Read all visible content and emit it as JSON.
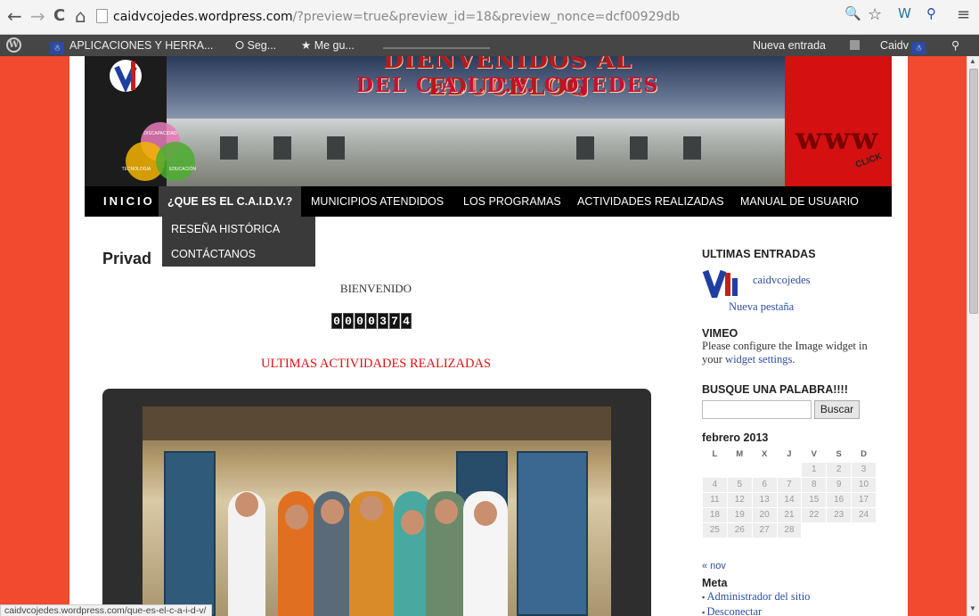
{
  "browser": {
    "url_host": "caidvcojedes.wordpress.com",
    "url_rest": "/?preview=true&preview_id=18&preview_nonce=dcf00929db",
    "back_glyph": "←",
    "forward_glyph": "→",
    "reload_glyph": "C",
    "home_glyph": "⌂",
    "zoom_glyph": "🔍",
    "star_glyph": "☆",
    "menu_glyph": "≡"
  },
  "admin_bar": {
    "site_name": "APLICACIONES Y HERRA...",
    "item2": "Seg...",
    "item3": "Me gu...",
    "new_entry": "Nueva entrada",
    "user": "Caidv"
  },
  "header": {
    "title": "DIENVENIDOS AL EDUCBLOG",
    "subtitle": "DEL C.A.I.D.V. COJEDES",
    "venn_labels": [
      "DISCAPACIDAD",
      "TECNOLOGIA",
      "EDUCACIÓN"
    ],
    "www": "www",
    "click": "CLICK"
  },
  "nav": {
    "home": "INICIO",
    "what": "¿QUE ES EL C.A.I.D.V.?",
    "municipalities": "MUNICIPIOS ATENDIDOS",
    "programs": "LOS PROGRAMAS",
    "activities": "ACTIVIDADES REALIZADAS",
    "manual": "MANUAL DE USUARIO",
    "dropdown": [
      "RESEÑA HISTÓRICA",
      "CONTÁCTANOS"
    ]
  },
  "content": {
    "post_title": "Privad",
    "welcome": "BIENVENIDO",
    "counter_digits": [
      "0",
      "0",
      "0",
      "0",
      "3",
      "7",
      "4"
    ],
    "activities_heading": "ULTIMAS ACTIVIDADES REALIZADAS"
  },
  "sidebar": {
    "latest_title": "ULTIMAS ENTRADAS",
    "latest_link": "caidvcojedes",
    "new_tab": "Nueva pestaña",
    "vimeo_title": "VIMEO",
    "vimeo_text": "Please configure the Image widget in your",
    "vimeo_link": "widget settings",
    "vimeo_end": ".",
    "search_title": "BUSQUE UNA PALABRA!!!!",
    "search_button": "Buscar",
    "calendar_title": "febrero 2013",
    "calendar_days": [
      "L",
      "M",
      "X",
      "J",
      "V",
      "S",
      "D"
    ],
    "calendar_weeks": [
      [
        "",
        "",
        "",
        "",
        "1",
        "2",
        "3"
      ],
      [
        "4",
        "5",
        "6",
        "7",
        "8",
        "9",
        "10"
      ],
      [
        "11",
        "12",
        "13",
        "14",
        "15",
        "16",
        "17"
      ],
      [
        "18",
        "19",
        "20",
        "21",
        "22",
        "23",
        "24"
      ],
      [
        "25",
        "26",
        "27",
        "28",
        "",
        "",
        ""
      ]
    ],
    "prev_month": "« nov",
    "meta_title": "Meta",
    "meta_links": [
      "Administrador del sitio",
      "Desconectar"
    ]
  },
  "status_bar": "caidvcojedes.wordpress.com/que-es-el-c-a-i-d-v/"
}
